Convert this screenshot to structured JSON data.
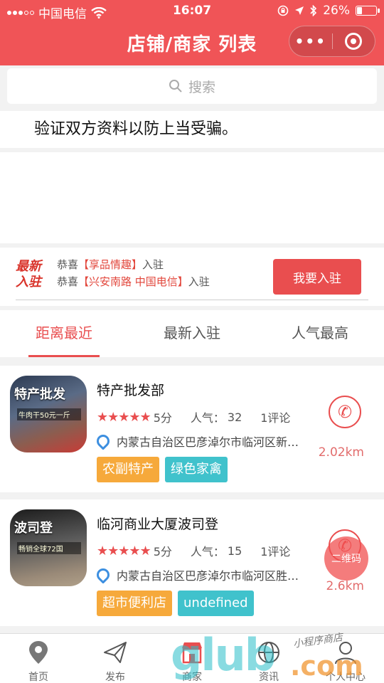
{
  "status_bar": {
    "carrier": "中国电信",
    "time": "16:07",
    "battery": "26%",
    "battery_level": 0.26
  },
  "nav": {
    "title": "店铺/商家 列表",
    "menu_dots": "•••"
  },
  "search": {
    "placeholder": "搜索"
  },
  "notice": {
    "text": "验证双方资料以防上当受骗。"
  },
  "settle": {
    "logo_line1": "最新",
    "logo_line2": "入驻",
    "line1_prefix": "恭喜",
    "line1_name": "【享品情趣】",
    "line1_suffix": "入驻",
    "line2_prefix": "恭喜",
    "line2_name": "【兴安南路 中国电信】",
    "line2_suffix": "入驻",
    "join_label": "我要入驻"
  },
  "tabs": [
    {
      "label": "距离最近",
      "active": true
    },
    {
      "label": "最新入驻",
      "active": false
    },
    {
      "label": "人气最高",
      "active": false
    }
  ],
  "shops": [
    {
      "name": "特产批发部",
      "thumb_sign": "特产批发",
      "thumb_sub": "牛肉干50元一斤",
      "stars": "★★★★★",
      "score": "5分",
      "popularity_label": "人气：",
      "popularity": "32",
      "comments": "1评论",
      "address": "内蒙古自治区巴彦淖尔市临河区新…",
      "tags": [
        "农副特产",
        "绿色家禽"
      ],
      "distance": "2.02km"
    },
    {
      "name": "临河商业大厦波司登",
      "thumb_sign": "波司登",
      "thumb_sub": "畅销全球72国",
      "stars": "★★★★★",
      "score": "5分",
      "popularity_label": "人气：",
      "popularity": "15",
      "comments": "1评论",
      "address": "内蒙古自治区巴彦淖尔市临河区胜…",
      "tags": [
        "超市便利店",
        "undefined"
      ],
      "distance": "2.6km"
    }
  ],
  "qr_overlay": "二维码",
  "bottom_tabs": [
    {
      "label": "首页",
      "icon": "location-pin-icon"
    },
    {
      "label": "发布",
      "icon": "paper-plane-icon"
    },
    {
      "label": "商家",
      "icon": "shop-icon"
    },
    {
      "label": "资讯",
      "icon": "globe-icon"
    },
    {
      "label": "个人中心",
      "icon": "user-icon"
    }
  ],
  "watermark": {
    "brand": "glub",
    "domain": ".com",
    "handwriting": "小程序商店"
  },
  "colors": {
    "brand_red": "#f05457",
    "accent_red": "#e94e4f",
    "tag_orange": "#f6a93b",
    "tag_teal": "#40c2cc",
    "pin_blue": "#3d8fe0"
  }
}
